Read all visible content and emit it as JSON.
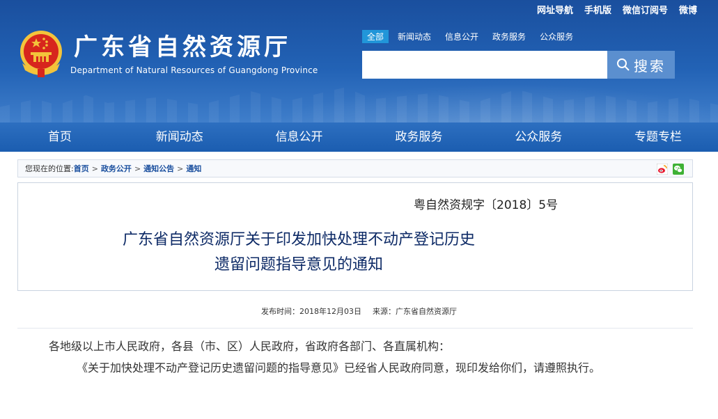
{
  "header": {
    "top_links": [
      "网址导航",
      "手机版",
      "微信订阅号",
      "微博"
    ],
    "site_title": "广东省自然资源厅",
    "site_subtitle": "Department of Natural Resources of Guangdong Province",
    "emblem_icon": "national-emblem-icon",
    "search": {
      "tabs": [
        "全部",
        "新闻动态",
        "信息公开",
        "政务服务",
        "公众服务"
      ],
      "active_tab": "全部",
      "placeholder": "",
      "button_label": "搜索"
    }
  },
  "nav": {
    "items": [
      "首页",
      "新闻动态",
      "信息公开",
      "政务服务",
      "公众服务",
      "专题专栏"
    ]
  },
  "breadcrumb": {
    "prefix": "您现在的位置:",
    "items": [
      "首页",
      "政务公开",
      "通知公告",
      "通知"
    ],
    "separator": ">",
    "share_icons": [
      "weibo-icon",
      "wechat-icon"
    ]
  },
  "article": {
    "doc_number": "粤自然资规字〔2018〕5号",
    "title_line1": "广东省自然资源厅关于印发加快处理不动产登记历史",
    "title_line2": "遗留问题指导意见的通知",
    "publish_label": "发布时间：",
    "publish_date": "2018年12月03日",
    "source_label": "来源：",
    "source": "广东省自然资源厅",
    "paragraphs": [
      "各地级以上市人民政府，各县（市、区）人民政府，省政府各部门、各直属机构：",
      "《关于加快处理不动产登记历史遗留问题的指导意见》已经省人民政府同意，现印发给你们，请遵照执行。"
    ]
  },
  "colors": {
    "header_blue": "#1a4f9e",
    "nav_blue": "#1b5db0",
    "active_tab": "#2196d9",
    "title_navy": "#0d2a66",
    "emblem_red": "#d7261d",
    "emblem_gold": "#f3c33b"
  }
}
